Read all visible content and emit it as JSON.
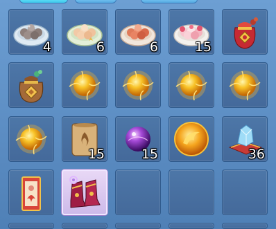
{
  "colors": {
    "panel_bg": "#5b8cc2",
    "slot_bg": "#4d77a8",
    "slot_selected_bg": "#e9d9f6",
    "qty_text": "#ffffff"
  },
  "inventory": {
    "slots": [
      {
        "item": "grey-rice-balls-plate-icon",
        "qty": "4"
      },
      {
        "item": "peach-rice-balls-plate-icon",
        "qty": "6"
      },
      {
        "item": "red-rice-balls-plate-icon",
        "qty": "6"
      },
      {
        "item": "flower-rice-balls-plate-icon",
        "qty": "15"
      },
      {
        "item": "red-lucky-bag-icon",
        "qty": ""
      },
      {
        "item": "brown-lucky-bag-icon",
        "qty": ""
      },
      {
        "item": "golden-orb-icon",
        "qty": ""
      },
      {
        "item": "golden-orb-icon",
        "qty": ""
      },
      {
        "item": "golden-orb-icon",
        "qty": ""
      },
      {
        "item": "golden-orb-icon",
        "qty": ""
      },
      {
        "item": "golden-orb-icon",
        "qty": ""
      },
      {
        "item": "fire-scroll-icon",
        "qty": "15"
      },
      {
        "item": "purple-orb-icon",
        "qty": "15"
      },
      {
        "item": "flame-disc-icon",
        "qty": ""
      },
      {
        "item": "crystal-cushion-icon",
        "qty": "36"
      },
      {
        "item": "red-charm-card-icon",
        "qty": ""
      },
      {
        "item": "armored-boots-icon",
        "qty": "",
        "selected": true
      },
      {
        "item": "",
        "qty": ""
      },
      {
        "item": "",
        "qty": ""
      },
      {
        "item": "",
        "qty": ""
      }
    ]
  }
}
